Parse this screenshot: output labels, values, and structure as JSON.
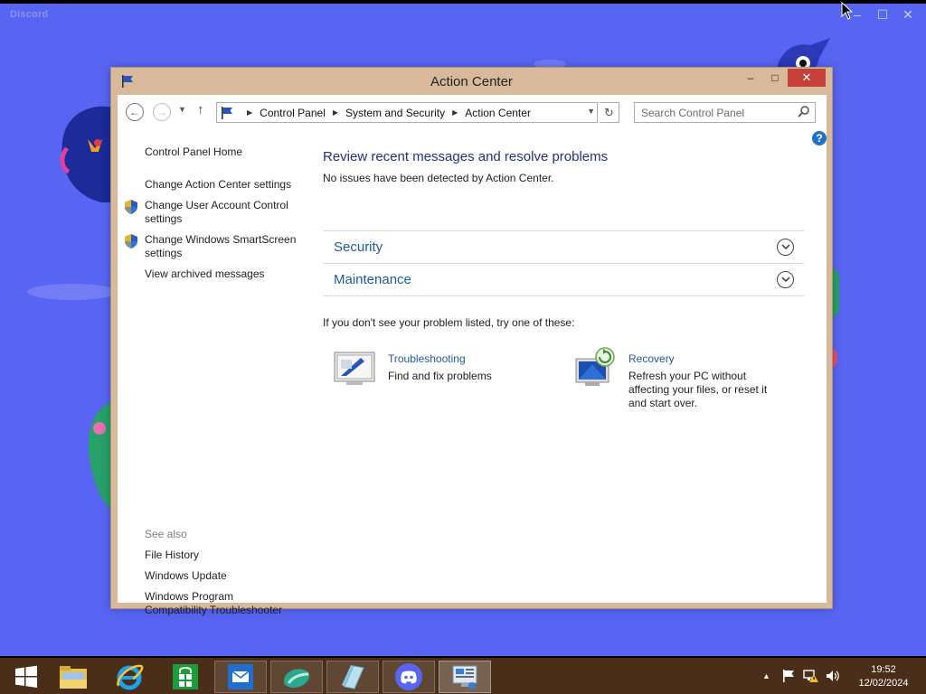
{
  "discord": {
    "app_title": "Discord",
    "controls": {
      "minimize": "–",
      "maximize": "☐",
      "close": "✕"
    }
  },
  "window": {
    "title": "Action Center",
    "controls": {
      "minimize": "–",
      "maximize": "□",
      "close": "✕"
    }
  },
  "nav": {
    "breadcrumb": [
      "Control Panel",
      "System and Security",
      "Action Center"
    ],
    "search_placeholder": "Search Control Panel",
    "help": "?"
  },
  "sidebar": {
    "home": "Control Panel Home",
    "links": {
      "action_center_settings": "Change Action Center settings",
      "uac_line1": "Change User Account Control",
      "uac_line2": "settings",
      "smartscreen_line1": "Change Windows SmartScreen",
      "smartscreen_line2": "settings",
      "archived": "View archived messages"
    },
    "see_also": {
      "heading": "See also",
      "file_history": "File History",
      "windows_update": "Windows Update",
      "compat_line1": "Windows Program",
      "compat_line2": "Compatibility Troubleshooter"
    }
  },
  "main": {
    "title": "Review recent messages and resolve problems",
    "subtitle": "No issues have been detected by Action Center.",
    "sections": {
      "security": "Security",
      "maintenance": "Maintenance"
    },
    "hint": "If you don't see your problem listed, try one of these:",
    "troubleshooting": {
      "title": "Troubleshooting",
      "desc": "Find and fix problems"
    },
    "recovery": {
      "title": "Recovery",
      "desc_line1": "Refresh your PC without",
      "desc_line2": "affecting your files, or reset it",
      "desc_line3": "and start over."
    }
  },
  "taskbar": {
    "apps": [
      "start-icon",
      "file-explorer-icon",
      "internet-explorer-icon",
      "store-icon",
      "mail-icon",
      "photos-icon",
      "reader-icon",
      "discord-icon",
      "control-panel-icon"
    ],
    "clock": {
      "time": "19:52",
      "date": "12/02/2024"
    }
  },
  "colors": {
    "discord_bg": "#5865f2",
    "window_frame": "#d8b99c",
    "link_blue": "#1e5aa0",
    "title_blue": "#1e3287",
    "taskbar": "#4a2e19",
    "close_red": "#c7413b"
  }
}
